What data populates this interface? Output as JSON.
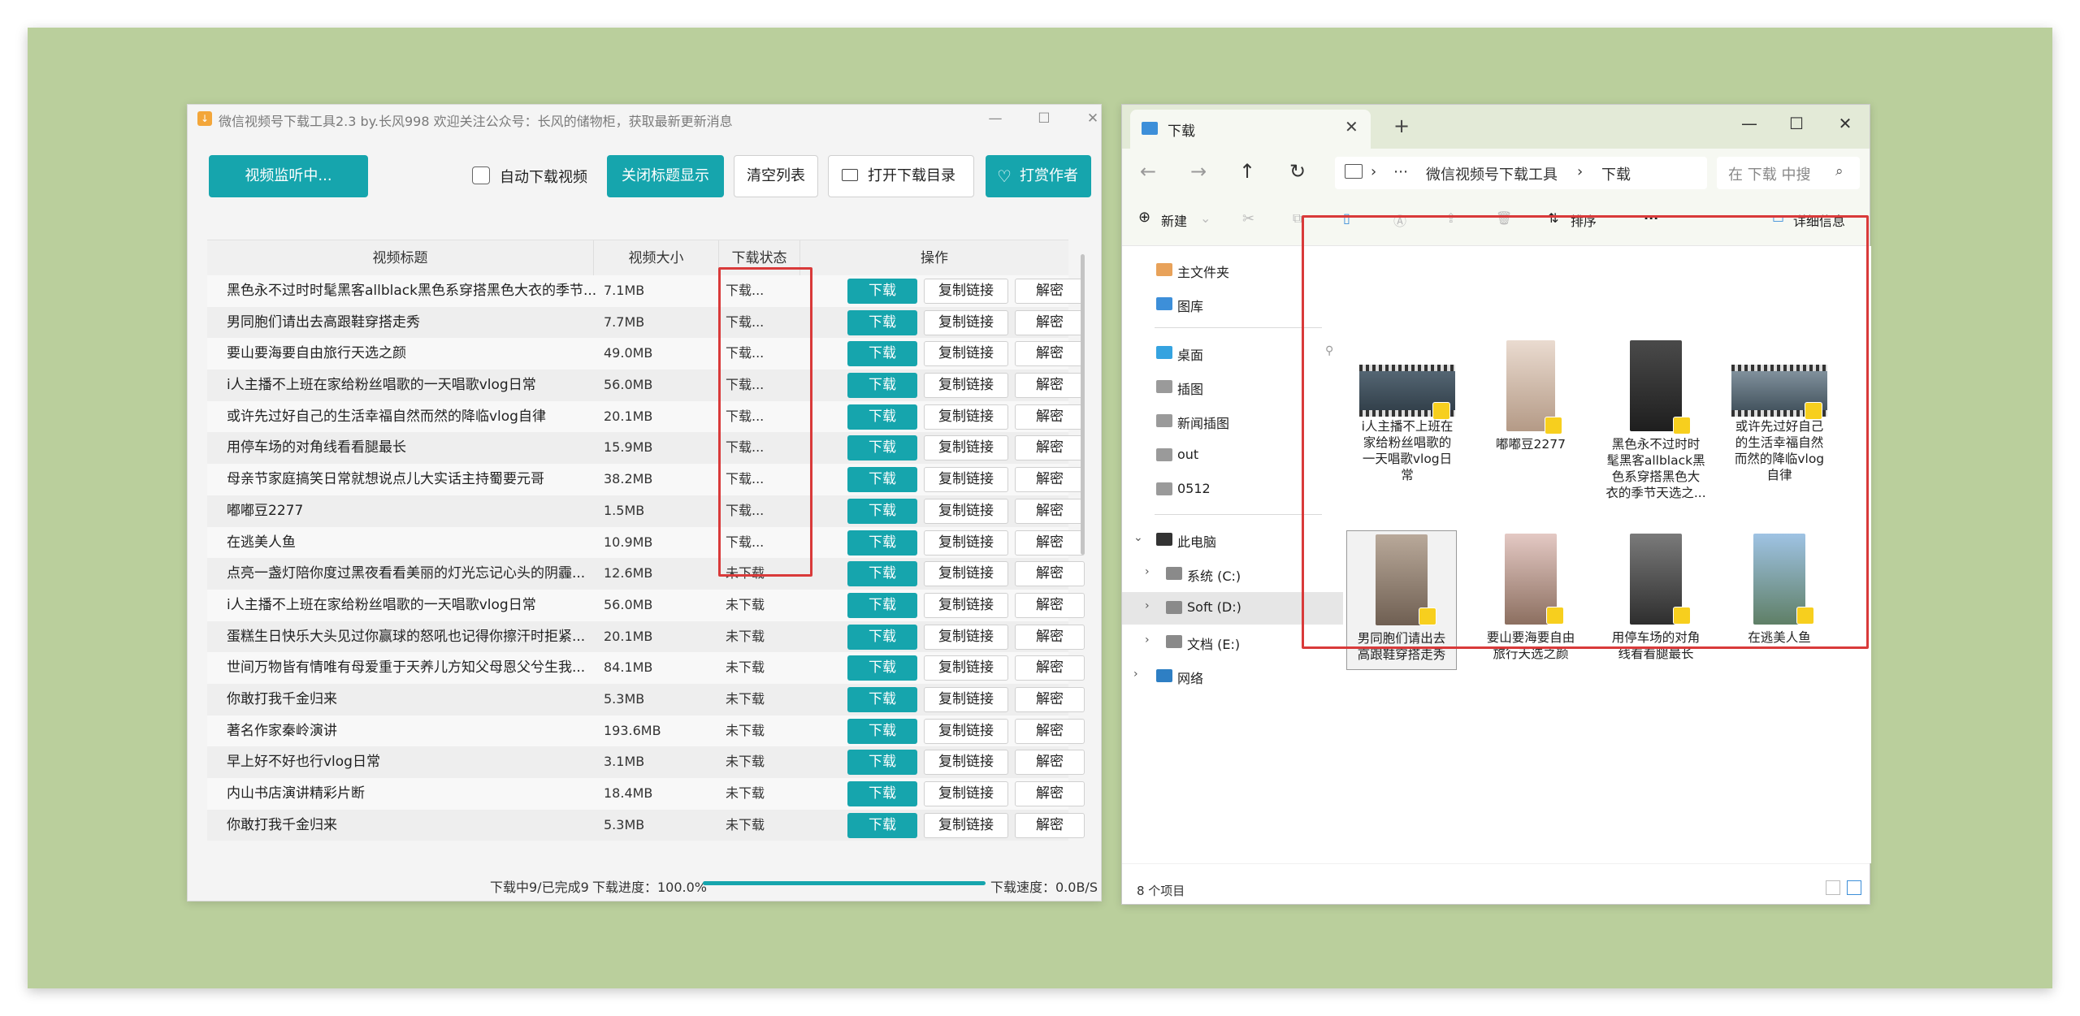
{
  "downloader": {
    "title": "微信视频号下载工具2.3 by.长风998  欢迎关注公众号：长风的储物柜，获取最新更新消息",
    "window_controls": [
      "—",
      "☐",
      "✕"
    ],
    "monitor_button": "视频监听中...",
    "auto_download_label": "自动下载视频",
    "toggle_title_button": "关闭标题显示",
    "clear_list_button": "清空列表",
    "open_dir_button": "打开下载目录",
    "tip_button": "打赏作者",
    "columns": [
      "视频标题",
      "视频大小",
      "下载状态",
      "操作"
    ],
    "download_label": "下载",
    "copy_label": "复制链接",
    "decrypt_label": "解密",
    "rows": [
      {
        "title": "黑色永不过时时髦黑客allblack黑色系穿搭黑色大衣的季节...",
        "size": "7.1MB",
        "status": "下载..."
      },
      {
        "title": "男同胞们请出去高跟鞋穿搭走秀",
        "size": "7.7MB",
        "status": "下载..."
      },
      {
        "title": "要山要海要自由旅行天选之颜",
        "size": "49.0MB",
        "status": "下载..."
      },
      {
        "title": "i人主播不上班在家给粉丝唱歌的一天唱歌vlog日常",
        "size": "56.0MB",
        "status": "下载..."
      },
      {
        "title": "或许先过好自己的生活幸福自然而然的降临vlog自律",
        "size": "20.1MB",
        "status": "下载..."
      },
      {
        "title": "用停车场的对角线看看腿最长",
        "size": "15.9MB",
        "status": "下载..."
      },
      {
        "title": "母亲节家庭搞笑日常就想说点儿大实话主持蜀要元哥",
        "size": "38.2MB",
        "status": "下载..."
      },
      {
        "title": "嘟嘟豆2277",
        "size": "1.5MB",
        "status": "下载..."
      },
      {
        "title": "在逃美人鱼",
        "size": "10.9MB",
        "status": "下载..."
      },
      {
        "title": "点亮一盏灯陪你度过黑夜看看美丽的灯光忘记心头的阴霾...",
        "size": "12.6MB",
        "status": "未下载"
      },
      {
        "title": "i人主播不上班在家给粉丝唱歌的一天唱歌vlog日常",
        "size": "56.0MB",
        "status": "未下载"
      },
      {
        "title": "蛋糕生日快乐大头见过你赢球的怒吼也记得你擦汗时拒紧...",
        "size": "20.1MB",
        "status": "未下载"
      },
      {
        "title": "世间万物皆有情唯有母爱重于天养儿方知父母恩父兮生我...",
        "size": "84.1MB",
        "status": "未下载"
      },
      {
        "title": "你敢打我千金归来",
        "size": "5.3MB",
        "status": "未下载"
      },
      {
        "title": "著名作家秦岭演讲",
        "size": "193.6MB",
        "status": "未下载"
      },
      {
        "title": "早上好不好也行vlog日常",
        "size": "3.1MB",
        "status": "未下载"
      },
      {
        "title": "内山书店演讲精彩片断",
        "size": "18.4MB",
        "status": "未下载"
      },
      {
        "title": "你敢打我千金归来",
        "size": "5.3MB",
        "status": "未下载"
      }
    ],
    "status_count": "下载中9/已完成9",
    "progress_label": "下载进度：100.0%",
    "progress_fraction": 1.0,
    "speed_label": "下载速度：0.0B/S"
  },
  "explorer": {
    "tab_title": "下载",
    "breadcrumb": [
      "⋯",
      "微信视频号下载工具",
      "下载"
    ],
    "search_placeholder": "在 下载 中搜",
    "toolbar": {
      "new": "新建",
      "sort": "排序",
      "more": "···",
      "details": "详细信息"
    },
    "sidebar": {
      "home": "主文件夹",
      "gallery": "图库",
      "desktop": "桌面",
      "illustration": "插图",
      "news_images": "新闻插图",
      "out": "out",
      "d0512": "0512",
      "this_pc": "此电脑",
      "drive_c": "系统 (C:)",
      "drive_d": "Soft (D:)",
      "drive_e": "文档 (E:)",
      "network": "网络"
    },
    "files": [
      {
        "name": "i人主播不上班在家给粉丝唱歌的一天唱歌vlog日常",
        "lines": [
          "i人主播不上班在",
          "家给粉丝唱歌的",
          "一天唱歌vlog日",
          "常"
        ]
      },
      {
        "name": "嘟嘟豆2277",
        "lines": [
          "嘟嘟豆2277"
        ]
      },
      {
        "name": "黑色永不过时时髦黑客allblack黑色系穿搭黑色大衣的季节天选之...",
        "lines": [
          "黑色永不过时时",
          "髦黑客allblack黑",
          "色系穿搭黑色大",
          "衣的季节天选之..."
        ]
      },
      {
        "name": "或许先过好自己的生活幸福自然而然的降临vlog自律",
        "lines": [
          "或许先过好自己",
          "的生活幸福自然",
          "而然的降临vlog",
          "自律"
        ]
      },
      {
        "name": "男同胞们请出去高跟鞋穿搭走秀",
        "lines": [
          "男同胞们请出去",
          "高跟鞋穿搭走秀"
        ]
      },
      {
        "name": "要山要海要自由旅行天选之颜",
        "lines": [
          "要山要海要自由",
          "旅行天选之颜"
        ]
      },
      {
        "name": "用停车场的对角线看看腿最长",
        "lines": [
          "用停车场的对角",
          "线看看腿最长"
        ]
      },
      {
        "name": "在逃美人鱼",
        "lines": [
          "在逃美人鱼"
        ]
      }
    ],
    "status": "8 个项目"
  }
}
